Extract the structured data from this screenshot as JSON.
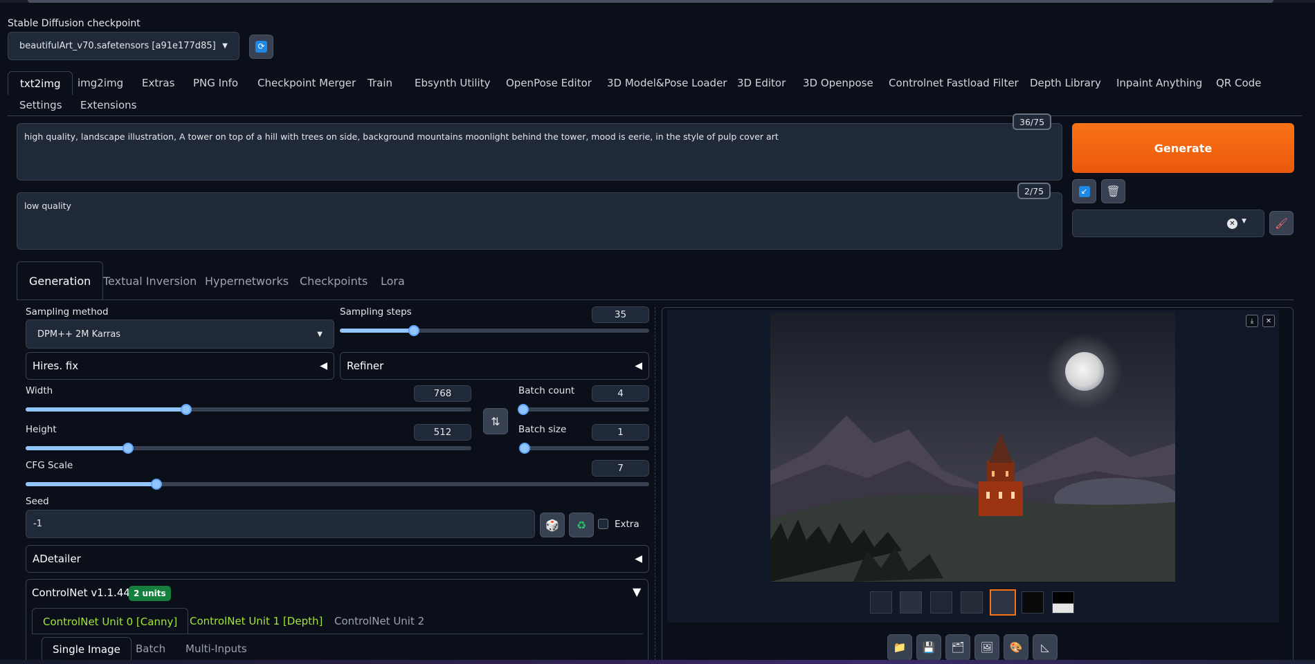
{
  "checkpoint": {
    "label": "Stable Diffusion checkpoint",
    "value": "beautifulArt_v70.safetensors [a91e177d85]",
    "refresh_icon": "refresh-icon"
  },
  "main_tabs": [
    "txt2img",
    "img2img",
    "Extras",
    "PNG Info",
    "Checkpoint Merger",
    "Train",
    "Ebsynth Utility",
    "OpenPose Editor",
    "3D Model&Pose Loader",
    "3D Editor",
    "3D Openpose",
    "Controlnet Fastload Filter",
    "Depth Library",
    "Inpaint Anything",
    "QR Code",
    "Settings",
    "Extensions"
  ],
  "prompt": {
    "positive": "high quality, landscape illustration, A tower on top of a hill with trees on side, background mountains moonlight behind the tower, mood is eerie, in the style of pulp cover art",
    "positive_tokens": "36/75",
    "negative": "low quality",
    "negative_tokens": "2/75"
  },
  "generate_label": "Generate",
  "sub_tabs": [
    "Generation",
    "Textual Inversion",
    "Hypernetworks",
    "Checkpoints",
    "Lora"
  ],
  "params": {
    "sampling_method_label": "Sampling method",
    "sampling_method_value": "DPM++ 2M Karras",
    "sampling_steps_label": "Sampling steps",
    "sampling_steps": "35",
    "hires_label": "Hires. fix",
    "refiner_label": "Refiner",
    "width_label": "Width",
    "width": "768",
    "height_label": "Height",
    "height": "512",
    "batch_count_label": "Batch count",
    "batch_count": "4",
    "batch_size_label": "Batch size",
    "batch_size": "1",
    "cfg_label": "CFG Scale",
    "cfg": "7",
    "seed_label": "Seed",
    "seed": "-1",
    "extra_label": "Extra"
  },
  "slider_levels": {
    "sampling_steps": 0.24,
    "width": 0.36,
    "height": 0.23,
    "batch_count": 0.02,
    "batch_size": 0.0,
    "cfg": 0.21
  },
  "adetailer_label": "ADetailer",
  "controlnet": {
    "title": "ControlNet v1.1.441",
    "badge": "2 units",
    "units": [
      "ControlNet Unit 0 [Canny]",
      "ControlNet Unit 1 [Depth]",
      "ControlNet Unit 2"
    ],
    "inner_tabs": [
      "Single Image",
      "Batch",
      "Multi-Inputs"
    ]
  },
  "colors": {
    "accent": "#f97316",
    "unit_active": "#a3e635",
    "slider": "#93c5fd",
    "badge": "#15803d"
  },
  "gallery": {
    "selected_thumb_index": 4,
    "thumb_count": 7,
    "action_icons": [
      "folder-icon",
      "save-icon",
      "zip-icon",
      "image-icon",
      "palette-icon",
      "ruler-icon"
    ]
  }
}
